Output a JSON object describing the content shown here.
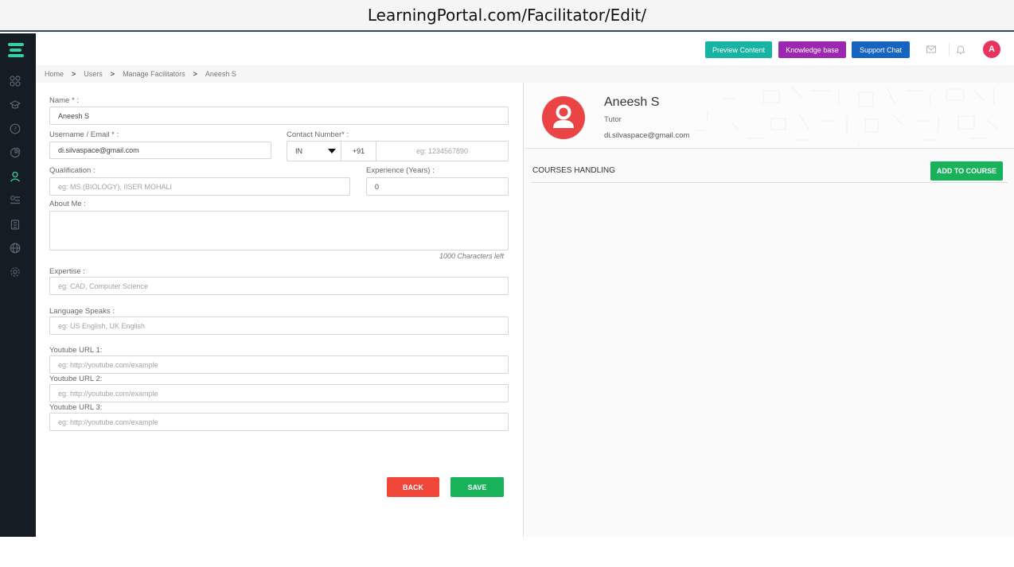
{
  "browser": {
    "url": "LearningPortal.com/Facilitator/Edit/"
  },
  "topbar": {
    "preview_label": "Preview Content",
    "knowledge_label": "Knowledge base",
    "support_label": "Support Chat",
    "avatar_letter": "A",
    "colors": {
      "preview": "#17b3a3",
      "knowledge": "#9c27b0",
      "support": "#1565c0",
      "avatar": "#e8335e"
    }
  },
  "sidebar": {
    "icons": [
      "logo-icon",
      "dashboard-icon",
      "courses-icon",
      "help-icon",
      "reports-icon",
      "users-icon",
      "content-icon",
      "clipboard-icon",
      "globe-icon",
      "settings-icon"
    ],
    "accent": "#2fd1a5"
  },
  "breadcrumb": [
    "Home",
    "Users",
    "Manage Facilitators",
    "Aneesh S"
  ],
  "form": {
    "name_label": "Name * :",
    "name_value": "Aneesh S",
    "email_label": "Username / Email * :",
    "email_value": "di.silvaspace@gmail.com",
    "contact_label": "Contact Number* :",
    "country_value": "IN",
    "dial_code": "+91",
    "phone_placeholder": "eg: 1234567890",
    "qualification_label": "Qualification :",
    "qualification_placeholder": "eg: MS.(BIOLOGY), IISER MOHALI",
    "experience_label": "Experience (Years) :",
    "experience_value": "0",
    "about_label": "About Me :",
    "about_counter": "1000 Characters left",
    "expertise_label": "Expertise :",
    "expertise_placeholder": "eg: CAD, Computer Science",
    "language_label": "Language Speaks :",
    "language_placeholder": "eg: US English, UK English",
    "yt1_label": "Youtube URL 1:",
    "yt2_label": "Youtube URL 2:",
    "yt3_label": "Youtube URL 3:",
    "yt_placeholder": "eg: http://youtube.com/example",
    "back_label": "BACK",
    "save_label": "SAVE"
  },
  "profile": {
    "name": "Aneesh S",
    "role": "Tutor",
    "email": "di.silvaspace@gmail.com"
  },
  "courses": {
    "title": "COURSES HANDLING",
    "add_label": "ADD TO COURSE"
  }
}
